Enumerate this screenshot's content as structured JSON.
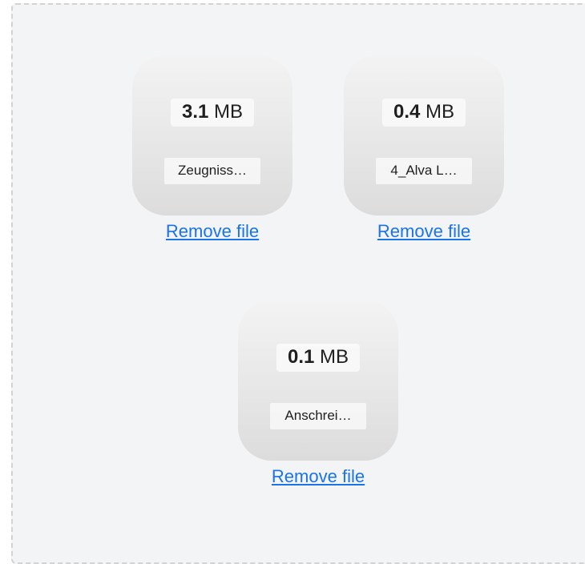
{
  "dropzone": {
    "files": [
      {
        "size_value": "3.1",
        "size_unit": "MB",
        "name": "Zeugniss…",
        "remove_label": "Remove file"
      },
      {
        "size_value": "0.4",
        "size_unit": "MB",
        "name": "4_Alva L…",
        "remove_label": "Remove file"
      },
      {
        "size_value": "0.1",
        "size_unit": "MB",
        "name": "Anschrei…",
        "remove_label": "Remove file"
      }
    ]
  },
  "colors": {
    "background": "#f3f4f6",
    "border": "#d3d3d3",
    "link": "#1a73e8"
  }
}
